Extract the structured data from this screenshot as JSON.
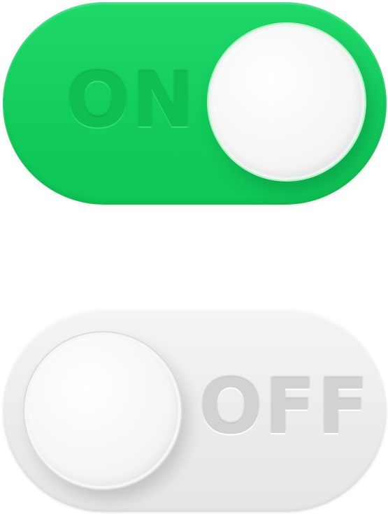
{
  "toggles": {
    "on": {
      "label": "ON",
      "state": "on",
      "track_color": "#14cf5e",
      "label_color": "#0fbf52"
    },
    "off": {
      "label": "OFF",
      "state": "off",
      "track_color": "#ececec",
      "label_color": "#d2d2d2"
    },
    "knob_color": "#f7f7f7"
  }
}
